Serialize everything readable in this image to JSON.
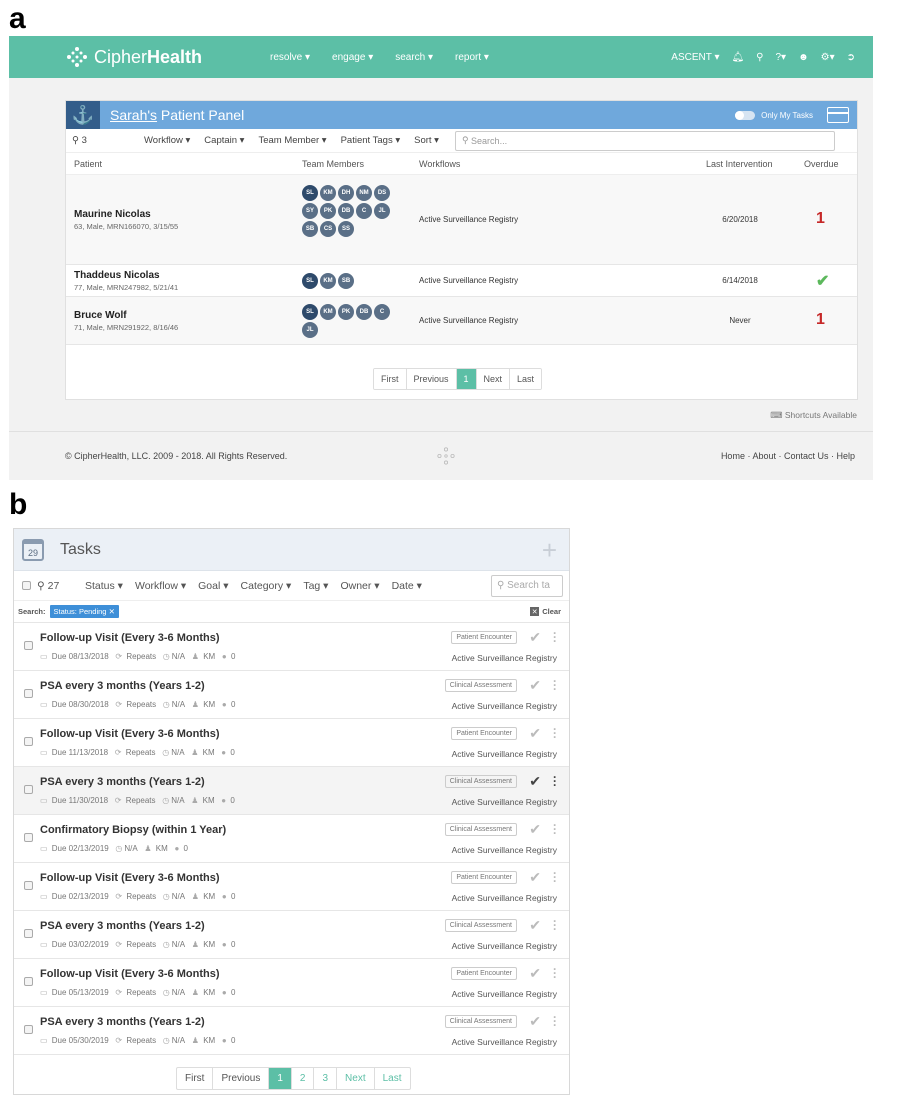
{
  "labels": {
    "a": "a",
    "b": "b"
  },
  "panel_a": {
    "brand": {
      "prefix": "Cipher",
      "bold": "Health"
    },
    "nav_left": [
      "resolve ▾",
      "engage ▾",
      "search ▾",
      "report ▾"
    ],
    "nav_right": {
      "org": "ASCENT ▾"
    },
    "panel_title_prefix": "Sarah's",
    "panel_title_rest": " Patient Panel",
    "only_my_tasks": "Only My Tasks",
    "count": "3",
    "filters": [
      "Workflow ▾",
      "Captain ▾",
      "Team Member ▾",
      "Patient Tags ▾",
      "Sort ▾"
    ],
    "search_placeholder": "Search...",
    "columns": {
      "patient": "Patient",
      "team": "Team Members",
      "workflows": "Workflows",
      "last": "Last Intervention",
      "overdue": "Overdue"
    },
    "patients": [
      {
        "name": "Maurine Nicolas",
        "details": "63, Male, MRN166070, 3/15/55",
        "members": [
          "SL",
          "KM",
          "DH",
          "NM",
          "DS",
          "SY",
          "PK",
          "DB",
          "C",
          "JL",
          "SB",
          "CS",
          "SS"
        ],
        "workflow": "Active Surveillance Registry",
        "last": "6/20/2018",
        "overdue": "1"
      },
      {
        "name": "Thaddeus Nicolas",
        "details": "77, Male, MRN247982, 5/21/41",
        "members": [
          "SL",
          "KM",
          "SB"
        ],
        "workflow": "Active Surveillance Registry",
        "last": "6/14/2018",
        "overdue": "✔"
      },
      {
        "name": "Bruce Wolf",
        "details": "71, Male, MRN291922, 8/16/46",
        "members": [
          "SL",
          "KM",
          "PK",
          "DB",
          "C",
          "JL"
        ],
        "workflow": "Active Surveillance Registry",
        "last": "Never",
        "overdue": "1"
      }
    ],
    "pagination": [
      "First",
      "Previous",
      "1",
      "Next",
      "Last"
    ],
    "shortcuts": "Shortcuts Available",
    "copyright": "© CipherHealth, LLC. 2009 - 2018. All Rights Reserved.",
    "footer_links": "Home · About · Contact Us · Help"
  },
  "panel_b": {
    "calendar_day": "29",
    "title": "Tasks",
    "count": "27",
    "filters": [
      "Status ▾",
      "Workflow ▾",
      "Goal ▾",
      "Category ▾",
      "Tag ▾",
      "Owner ▾",
      "Date ▾"
    ],
    "search_placeholder": "Search ta",
    "search_label": "Search:",
    "status_chip": "Status: Pending",
    "chip_close": "✕",
    "clear": "Clear",
    "tasks": [
      {
        "title": "Follow-up Visit (Every 3-6 Months)",
        "due": "Due 08/13/2018",
        "repeats": "Repeats",
        "time": "N/A",
        "owner": "KM",
        "comments": "0",
        "category": "Patient Encounter",
        "workflow": "Active Surveillance Registry"
      },
      {
        "title": "PSA every 3 months (Years 1-2)",
        "due": "Due 08/30/2018",
        "repeats": "Repeats",
        "time": "N/A",
        "owner": "KM",
        "comments": "0",
        "category": "Clinical Assessment",
        "workflow": "Active Surveillance Registry"
      },
      {
        "title": "Follow-up Visit (Every 3-6 Months)",
        "due": "Due 11/13/2018",
        "repeats": "Repeats",
        "time": "N/A",
        "owner": "KM",
        "comments": "0",
        "category": "Patient Encounter",
        "workflow": "Active Surveillance Registry"
      },
      {
        "title": "PSA every 3 months (Years 1-2)",
        "due": "Due 11/30/2018",
        "repeats": "Repeats",
        "time": "N/A",
        "owner": "KM",
        "comments": "0",
        "category": "Clinical Assessment",
        "workflow": "Active Surveillance Registry",
        "highlighted": true
      },
      {
        "title": "Confirmatory Biopsy (within 1 Year)",
        "due": "Due 02/13/2019",
        "repeats": "",
        "time": "N/A",
        "owner": "KM",
        "comments": "0",
        "category": "Clinical Assessment",
        "workflow": "Active Surveillance Registry"
      },
      {
        "title": "Follow-up Visit (Every 3-6 Months)",
        "due": "Due 02/13/2019",
        "repeats": "Repeats",
        "time": "N/A",
        "owner": "KM",
        "comments": "0",
        "category": "Patient Encounter",
        "workflow": "Active Surveillance Registry"
      },
      {
        "title": "PSA every 3 months (Years 1-2)",
        "due": "Due 03/02/2019",
        "repeats": "Repeats",
        "time": "N/A",
        "owner": "KM",
        "comments": "0",
        "category": "Clinical Assessment",
        "workflow": "Active Surveillance Registry"
      },
      {
        "title": "Follow-up Visit (Every 3-6 Months)",
        "due": "Due 05/13/2019",
        "repeats": "Repeats",
        "time": "N/A",
        "owner": "KM",
        "comments": "0",
        "category": "Patient Encounter",
        "workflow": "Active Surveillance Registry"
      },
      {
        "title": "PSA every 3 months (Years 1-2)",
        "due": "Due 05/30/2019",
        "repeats": "Repeats",
        "time": "N/A",
        "owner": "KM",
        "comments": "0",
        "category": "Clinical Assessment",
        "workflow": "Active Surveillance Registry"
      }
    ],
    "pagination": [
      "First",
      "Previous",
      "1",
      "2",
      "3",
      "Next",
      "Last"
    ],
    "active_page": "1"
  },
  "colors": {
    "brand": "#5cbfa6",
    "panel_header": "#6fa8dc",
    "overdue": "#c62828",
    "ok": "#5cb85c",
    "chip": "#3e8fd8"
  }
}
